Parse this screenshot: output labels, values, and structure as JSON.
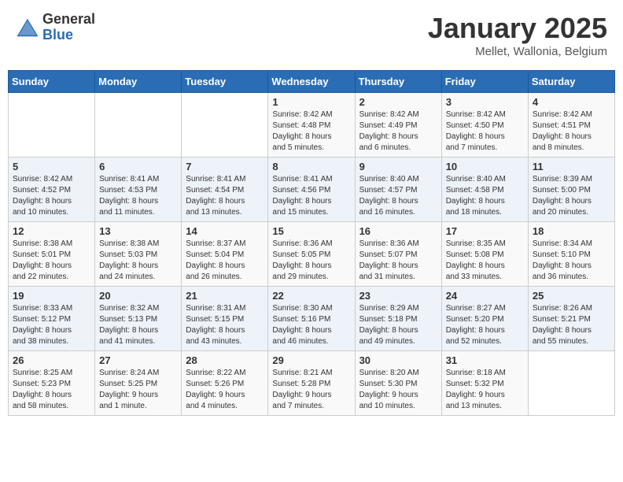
{
  "header": {
    "logo_general": "General",
    "logo_blue": "Blue",
    "month_title": "January 2025",
    "location": "Mellet, Wallonia, Belgium"
  },
  "days_of_week": [
    "Sunday",
    "Monday",
    "Tuesday",
    "Wednesday",
    "Thursday",
    "Friday",
    "Saturday"
  ],
  "weeks": [
    [
      {
        "day": "",
        "info": ""
      },
      {
        "day": "",
        "info": ""
      },
      {
        "day": "",
        "info": ""
      },
      {
        "day": "1",
        "info": "Sunrise: 8:42 AM\nSunset: 4:48 PM\nDaylight: 8 hours\nand 5 minutes."
      },
      {
        "day": "2",
        "info": "Sunrise: 8:42 AM\nSunset: 4:49 PM\nDaylight: 8 hours\nand 6 minutes."
      },
      {
        "day": "3",
        "info": "Sunrise: 8:42 AM\nSunset: 4:50 PM\nDaylight: 8 hours\nand 7 minutes."
      },
      {
        "day": "4",
        "info": "Sunrise: 8:42 AM\nSunset: 4:51 PM\nDaylight: 8 hours\nand 8 minutes."
      }
    ],
    [
      {
        "day": "5",
        "info": "Sunrise: 8:42 AM\nSunset: 4:52 PM\nDaylight: 8 hours\nand 10 minutes."
      },
      {
        "day": "6",
        "info": "Sunrise: 8:41 AM\nSunset: 4:53 PM\nDaylight: 8 hours\nand 11 minutes."
      },
      {
        "day": "7",
        "info": "Sunrise: 8:41 AM\nSunset: 4:54 PM\nDaylight: 8 hours\nand 13 minutes."
      },
      {
        "day": "8",
        "info": "Sunrise: 8:41 AM\nSunset: 4:56 PM\nDaylight: 8 hours\nand 15 minutes."
      },
      {
        "day": "9",
        "info": "Sunrise: 8:40 AM\nSunset: 4:57 PM\nDaylight: 8 hours\nand 16 minutes."
      },
      {
        "day": "10",
        "info": "Sunrise: 8:40 AM\nSunset: 4:58 PM\nDaylight: 8 hours\nand 18 minutes."
      },
      {
        "day": "11",
        "info": "Sunrise: 8:39 AM\nSunset: 5:00 PM\nDaylight: 8 hours\nand 20 minutes."
      }
    ],
    [
      {
        "day": "12",
        "info": "Sunrise: 8:38 AM\nSunset: 5:01 PM\nDaylight: 8 hours\nand 22 minutes."
      },
      {
        "day": "13",
        "info": "Sunrise: 8:38 AM\nSunset: 5:03 PM\nDaylight: 8 hours\nand 24 minutes."
      },
      {
        "day": "14",
        "info": "Sunrise: 8:37 AM\nSunset: 5:04 PM\nDaylight: 8 hours\nand 26 minutes."
      },
      {
        "day": "15",
        "info": "Sunrise: 8:36 AM\nSunset: 5:05 PM\nDaylight: 8 hours\nand 29 minutes."
      },
      {
        "day": "16",
        "info": "Sunrise: 8:36 AM\nSunset: 5:07 PM\nDaylight: 8 hours\nand 31 minutes."
      },
      {
        "day": "17",
        "info": "Sunrise: 8:35 AM\nSunset: 5:08 PM\nDaylight: 8 hours\nand 33 minutes."
      },
      {
        "day": "18",
        "info": "Sunrise: 8:34 AM\nSunset: 5:10 PM\nDaylight: 8 hours\nand 36 minutes."
      }
    ],
    [
      {
        "day": "19",
        "info": "Sunrise: 8:33 AM\nSunset: 5:12 PM\nDaylight: 8 hours\nand 38 minutes."
      },
      {
        "day": "20",
        "info": "Sunrise: 8:32 AM\nSunset: 5:13 PM\nDaylight: 8 hours\nand 41 minutes."
      },
      {
        "day": "21",
        "info": "Sunrise: 8:31 AM\nSunset: 5:15 PM\nDaylight: 8 hours\nand 43 minutes."
      },
      {
        "day": "22",
        "info": "Sunrise: 8:30 AM\nSunset: 5:16 PM\nDaylight: 8 hours\nand 46 minutes."
      },
      {
        "day": "23",
        "info": "Sunrise: 8:29 AM\nSunset: 5:18 PM\nDaylight: 8 hours\nand 49 minutes."
      },
      {
        "day": "24",
        "info": "Sunrise: 8:27 AM\nSunset: 5:20 PM\nDaylight: 8 hours\nand 52 minutes."
      },
      {
        "day": "25",
        "info": "Sunrise: 8:26 AM\nSunset: 5:21 PM\nDaylight: 8 hours\nand 55 minutes."
      }
    ],
    [
      {
        "day": "26",
        "info": "Sunrise: 8:25 AM\nSunset: 5:23 PM\nDaylight: 8 hours\nand 58 minutes."
      },
      {
        "day": "27",
        "info": "Sunrise: 8:24 AM\nSunset: 5:25 PM\nDaylight: 9 hours\nand 1 minute."
      },
      {
        "day": "28",
        "info": "Sunrise: 8:22 AM\nSunset: 5:26 PM\nDaylight: 9 hours\nand 4 minutes."
      },
      {
        "day": "29",
        "info": "Sunrise: 8:21 AM\nSunset: 5:28 PM\nDaylight: 9 hours\nand 7 minutes."
      },
      {
        "day": "30",
        "info": "Sunrise: 8:20 AM\nSunset: 5:30 PM\nDaylight: 9 hours\nand 10 minutes."
      },
      {
        "day": "31",
        "info": "Sunrise: 8:18 AM\nSunset: 5:32 PM\nDaylight: 9 hours\nand 13 minutes."
      },
      {
        "day": "",
        "info": ""
      }
    ]
  ]
}
